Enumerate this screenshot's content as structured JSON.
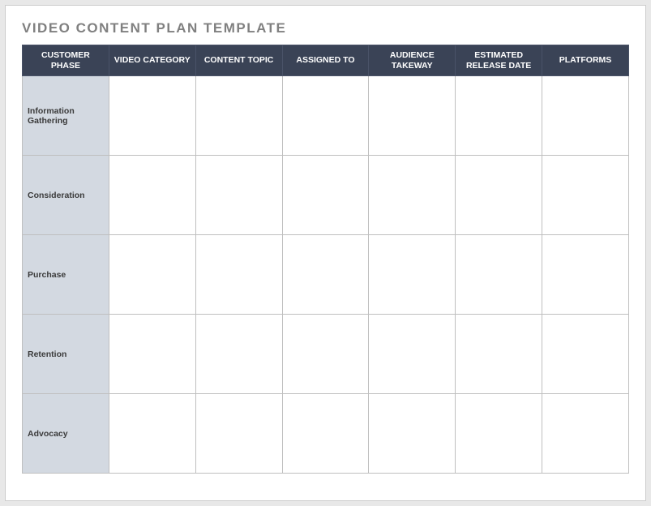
{
  "title": "VIDEO CONTENT PLAN TEMPLATE",
  "columns": [
    "CUSTOMER PHASE",
    "VIDEO CATEGORY",
    "CONTENT TOPIC",
    "ASSIGNED TO",
    "AUDIENCE TAKEWAY",
    "ESTIMATED RELEASE DATE",
    "PLATFORMS"
  ],
  "rows": [
    {
      "phase": "Information Gathering",
      "video_category": "",
      "content_topic": "",
      "assigned_to": "",
      "audience_takeway": "",
      "estimated_release_date": "",
      "platforms": ""
    },
    {
      "phase": "Consideration",
      "video_category": "",
      "content_topic": "",
      "assigned_to": "",
      "audience_takeway": "",
      "estimated_release_date": "",
      "platforms": ""
    },
    {
      "phase": "Purchase",
      "video_category": "",
      "content_topic": "",
      "assigned_to": "",
      "audience_takeway": "",
      "estimated_release_date": "",
      "platforms": ""
    },
    {
      "phase": "Retention",
      "video_category": "",
      "content_topic": "",
      "assigned_to": "",
      "audience_takeway": "",
      "estimated_release_date": "",
      "platforms": ""
    },
    {
      "phase": "Advocacy",
      "video_category": "",
      "content_topic": "",
      "assigned_to": "",
      "audience_takeway": "",
      "estimated_release_date": "",
      "platforms": ""
    }
  ]
}
